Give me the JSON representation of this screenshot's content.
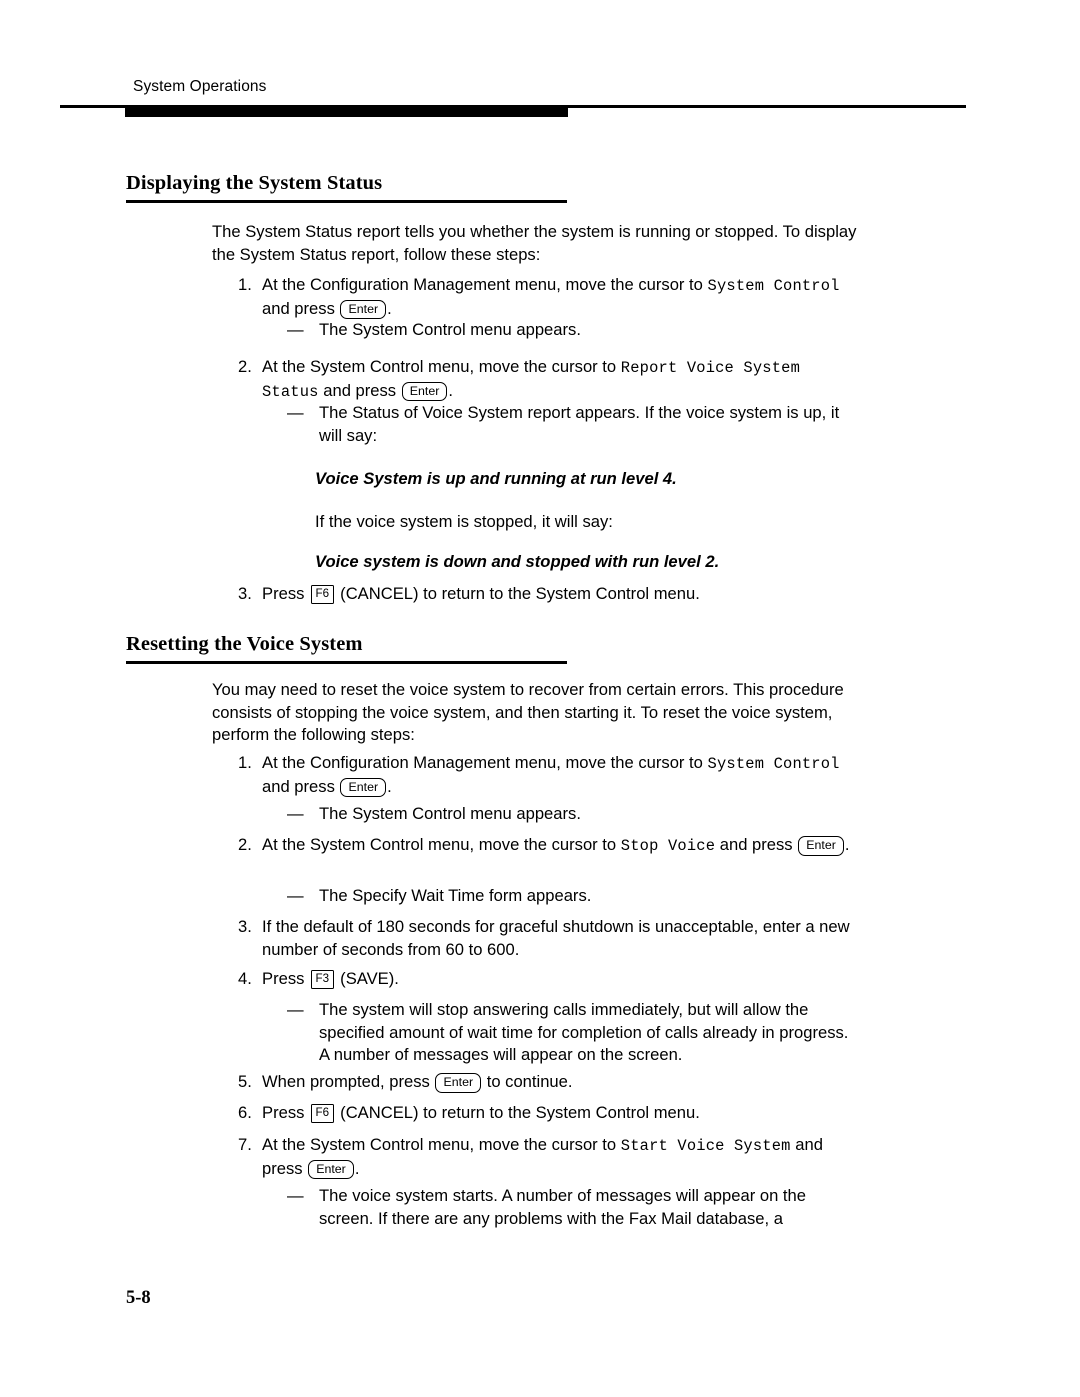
{
  "page": {
    "running_header": "System Operations",
    "folio": "5-8"
  },
  "sections": [
    {
      "heading": "Displaying the System Status",
      "intro": "The System Status report tells you whether the system is running or stopped.  To display the System Status report, follow these steps:",
      "steps": [
        {
          "number": "1.",
          "text_1": "At the Configuration Management menu, move the cursor to ",
          "mono_1": "System Control",
          "text_2": " and press ",
          "key": "Enter",
          "text_3": "."
        },
        {
          "number": "2.",
          "text_1": "At the System Control menu, move the cursor to ",
          "mono_1": "Report Voice System Status",
          "text_2": " and press ",
          "key": "Enter",
          "text_3": "."
        },
        {
          "number": "3.",
          "text_1": "Press ",
          "key": "F6",
          "text_2": " (CANCEL) to return to the System Control menu."
        }
      ],
      "dashes": {
        "after_step_1": "The System Control menu appears.",
        "after_step_2": "The Status of Voice System report appears.  If the voice system is up, it will say:"
      },
      "messages": {
        "up": "Voice System is up and running at run level 4.",
        "stopped_lead": "If the voice system is stopped, it will say:",
        "down": "Voice system is down and stopped with run level 2."
      }
    },
    {
      "heading": "Resetting the Voice System",
      "intro": "You may need to reset the voice system to recover from certain errors.  This procedure consists of stopping the voice system, and then starting it.  To reset the voice system, perform the following steps:",
      "steps": [
        {
          "number": "1.",
          "text_1": "At the Configuration Management menu, move the cursor to ",
          "mono_1": "System Control",
          "text_2": " and press ",
          "key": "Enter",
          "text_3": "."
        },
        {
          "number": "2.",
          "text_1": "At the System Control menu, move the cursor to ",
          "mono_1": "Stop Voice",
          "text_2": " and press ",
          "key": "Enter",
          "text_3": "."
        },
        {
          "number": "3.",
          "text_1": "If the default of 180 seconds for graceful shutdown is unacceptable, enter a new number of seconds from 60 to 600."
        },
        {
          "number": "4.",
          "text_1": "Press ",
          "key": "F3",
          "text_2": " (SAVE)."
        },
        {
          "number": "5.",
          "text_1": "When prompted, press ",
          "key": "Enter",
          "text_2": " to continue."
        },
        {
          "number": "6.",
          "text_1": "Press ",
          "key": "F6",
          "text_2": " (CANCEL) to return to the System Control menu."
        },
        {
          "number": "7.",
          "text_1": "At the System Control menu, move the cursor to ",
          "mono_1": "Start Voice System",
          "text_2": " and press ",
          "key": "Enter",
          "text_3": "."
        }
      ],
      "dashes": {
        "after_step_1": "The System Control menu appears.",
        "after_step_2": "The Specify Wait Time form appears.",
        "after_step_4": "The system will stop answering calls immediately, but will allow the specified amount of wait time for completion of calls already in progress.  A number of messages will appear on the screen.",
        "after_step_7": "The voice system starts.  A number of messages will appear on the screen.  If there are any problems with the Fax Mail database, a"
      }
    }
  ]
}
